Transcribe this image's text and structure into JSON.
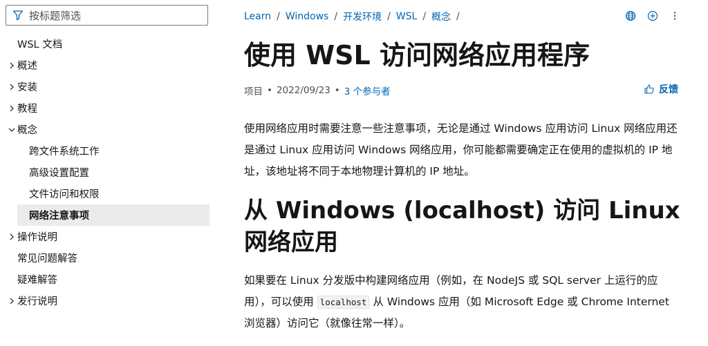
{
  "sidebar": {
    "filter_placeholder": "按标题筛选",
    "items": [
      {
        "label": "WSL 文档"
      },
      {
        "label": "概述"
      },
      {
        "label": "安装"
      },
      {
        "label": "教程"
      },
      {
        "label": "概念"
      },
      {
        "label": "跨文件系统工作"
      },
      {
        "label": "高级设置配置"
      },
      {
        "label": "文件访问和权限"
      },
      {
        "label": "网络注意事项"
      },
      {
        "label": "操作说明"
      },
      {
        "label": "常见问题解答"
      },
      {
        "label": "疑难解答"
      },
      {
        "label": "发行说明"
      }
    ]
  },
  "breadcrumb": [
    "Learn",
    "Windows",
    "开发环境",
    "WSL",
    "概念"
  ],
  "breadcrumb_sep": "/",
  "article": {
    "title": "使用 WSL 访问网络应用程序",
    "meta_type": "项目",
    "meta_date": "2022/09/23",
    "meta_contributors": "3 个参与者",
    "feedback_label": "反馈",
    "p1": "使用网络应用时需要注意一些注意事项，无论是通过 Windows 应用访问 Linux 网络应用还是通过 Linux 应用访问 Windows 网络应用，你可能都需要确定正在使用的虚拟机的 IP 地址，该地址将不同于本地物理计算机的 IP 地址。",
    "h2": "从 Windows (localhost) 访问 Linux 网络应用",
    "p2_before": "如果要在 Linux 分发版中构建网络应用（例如，在 NodeJS 或 SQL server 上运行的应用），可以使用 ",
    "p2_code": "localhost",
    "p2_after": " 从 Windows 应用（如 Microsoft Edge 或 Chrome Internet 浏览器）访问它（就像往常一样）。"
  },
  "icons": {
    "filter": "filter-icon",
    "globe": "globe-icon",
    "add": "add-circle-icon",
    "more": "more-vertical-icon",
    "feedback": "thumbs-up-icon"
  },
  "colors": {
    "link": "#0065b3",
    "active_bg": "#ebebeb",
    "text": "#161616"
  }
}
